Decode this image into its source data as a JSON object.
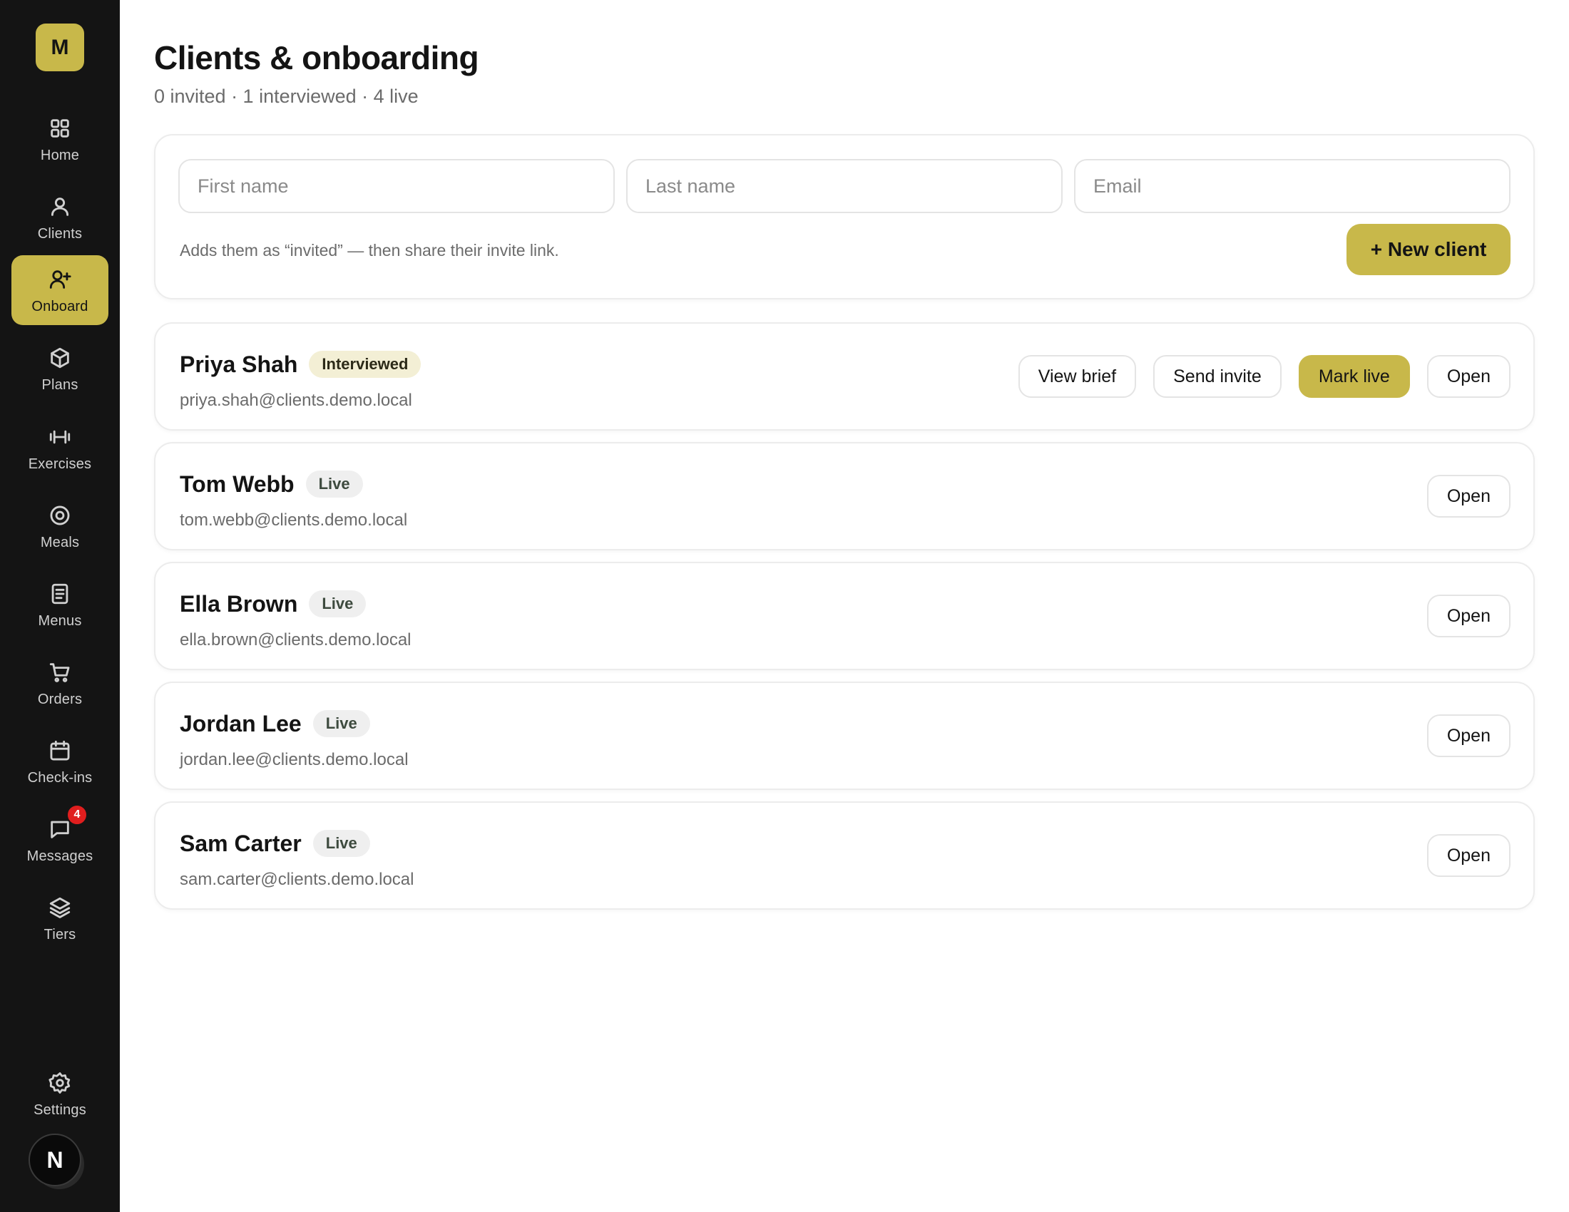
{
  "brand": {
    "logo_letter": "M",
    "accent": "#c8b84a",
    "sidebar_bg": "#141414",
    "badge_color": "#e01e1e"
  },
  "sidebar": {
    "items": [
      {
        "label": "Home",
        "icon": "grid-icon"
      },
      {
        "label": "Clients",
        "icon": "user-icon"
      },
      {
        "label": "Onboard",
        "icon": "user-plus-icon",
        "active": true
      },
      {
        "label": "Plans",
        "icon": "box-icon"
      },
      {
        "label": "Exercises",
        "icon": "dumbbell-icon"
      },
      {
        "label": "Meals",
        "icon": "target-icon"
      },
      {
        "label": "Menus",
        "icon": "document-icon"
      },
      {
        "label": "Orders",
        "icon": "cart-icon"
      },
      {
        "label": "Check-ins",
        "icon": "calendar-icon"
      },
      {
        "label": "Messages",
        "icon": "chat-icon",
        "badge": "4"
      },
      {
        "label": "Tiers",
        "icon": "layers-icon"
      }
    ],
    "settings": {
      "label": "Settings",
      "icon": "gear-icon"
    },
    "avatar_letter": "N"
  },
  "header": {
    "title": "Clients & onboarding",
    "subtitle": "0 invited · 1 interviewed · 4 live"
  },
  "new_client": {
    "first_name_placeholder": "First name",
    "last_name_placeholder": "Last name",
    "email_placeholder": "Email",
    "hint": "Adds them as “invited” — then share their invite link.",
    "button_label": "+ New client"
  },
  "actions": {
    "view_brief": "View brief",
    "send_invite": "Send invite",
    "mark_live": "Mark live",
    "open": "Open"
  },
  "clients": [
    {
      "name": "Priya Shah",
      "status": "Interviewed",
      "email": "priya.shah@clients.demo.local"
    },
    {
      "name": "Tom Webb",
      "status": "Live",
      "email": "tom.webb@clients.demo.local"
    },
    {
      "name": "Ella Brown",
      "status": "Live",
      "email": "ella.brown@clients.demo.local"
    },
    {
      "name": "Jordan Lee",
      "status": "Live",
      "email": "jordan.lee@clients.demo.local"
    },
    {
      "name": "Sam Carter",
      "status": "Live",
      "email": "sam.carter@clients.demo.local"
    }
  ]
}
